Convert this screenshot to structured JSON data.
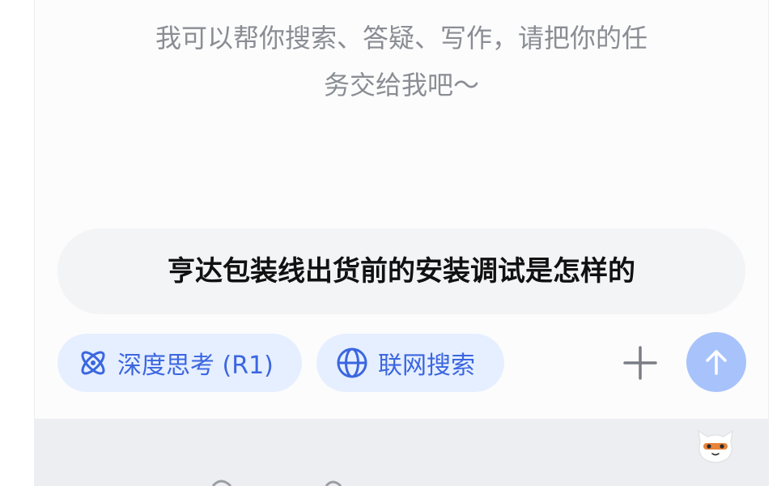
{
  "welcome": {
    "line1": "我可以帮你搜索、答疑、写作，请把你的任",
    "line2": "务交给我吧～"
  },
  "input": {
    "value": "亨达包装线出货前的安装调试是怎样的"
  },
  "toolbar": {
    "deep_think_label": "深度思考 (R1)",
    "web_search_label": "联网搜索"
  },
  "colors": {
    "accent": "#3b66e0",
    "chip_bg": "#e6efff",
    "send_bg": "#a8c3fb",
    "input_bg": "#f3f4f6",
    "footer_bg": "#edeef2"
  },
  "icons": {
    "deep_think": "atom-icon",
    "web_search": "globe-icon",
    "attach": "plus-icon",
    "send": "arrow-up-icon",
    "mascot": "mascot-icon"
  }
}
